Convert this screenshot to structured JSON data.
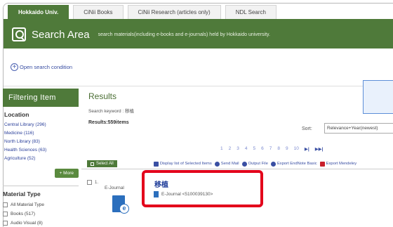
{
  "tabs": [
    {
      "label": "Hokkaido Univ."
    },
    {
      "label": "CiNii Books"
    },
    {
      "label": "CiNii Research (articles only)"
    },
    {
      "label": "NDL Search"
    }
  ],
  "search_area": {
    "title": "Search Area",
    "description": "search materials(including e-books and e-journals) held by Hokkaido university."
  },
  "open_condition": {
    "label": "Open search condition"
  },
  "sidebar": {
    "heading": "Filtering Item",
    "location_title": "Location",
    "locations": [
      "Central Library (296)",
      "Medicine (116)",
      "North Library (83)",
      "Health Sciences (63)",
      "Agriculture (52)"
    ],
    "more_label": "+ More",
    "material_title": "Material Type",
    "materials": [
      "All Material Type",
      "Books (517)",
      "Audio Visual (8)"
    ]
  },
  "results": {
    "title": "Results",
    "keyword": "Search keyword : 移植",
    "count": "Results:559items",
    "sort_label": "Sort:",
    "sort_value": "Relevance+Year(newest)",
    "pages": [
      "1",
      "2",
      "3",
      "4",
      "5",
      "6",
      "7",
      "8",
      "9",
      "10"
    ],
    "pager_next": "▶|",
    "pager_last": "▶▶|"
  },
  "toolbar": {
    "select_all": "Select All",
    "display_list": "Display list of Selected Items",
    "send_mail": "Send Mail",
    "output_file": "Output File",
    "export_endnote": "Export EndNote Basic",
    "export_mendeley": "Export Mendeley"
  },
  "result_item": {
    "number": "1.",
    "type": "E-Journal",
    "title": "移植",
    "subtitle": "E-Journal <5100039130>"
  }
}
